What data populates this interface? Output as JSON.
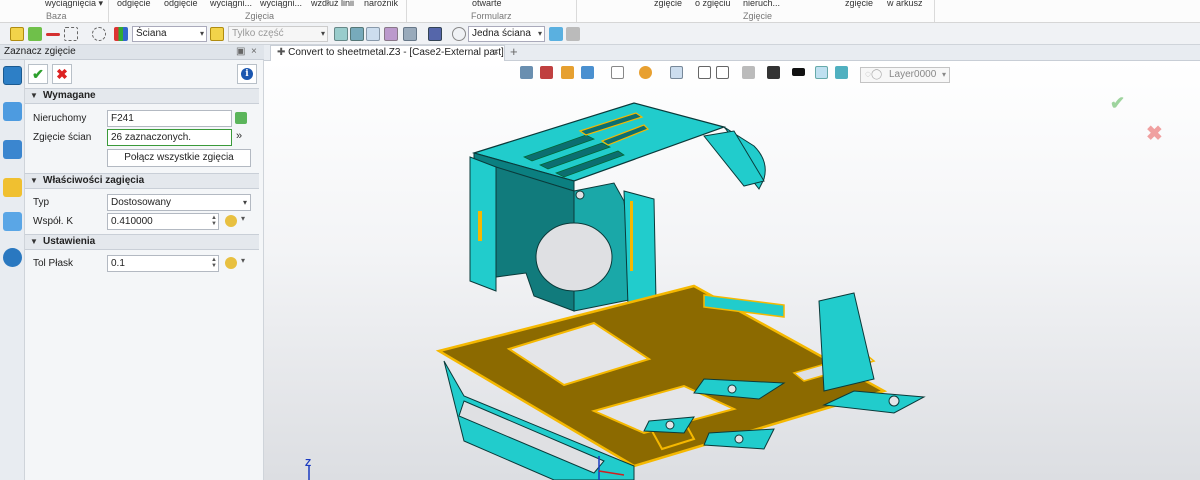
{
  "ribbon": {
    "items": [
      "wyciągnięcia ▾",
      "odgięcie",
      "odgięcie",
      "wyciągni...",
      "wyciągni...",
      "wzdłuż linii",
      "narożnik",
      "otwarte",
      "zgięcie",
      "o zgięciu",
      "nieruch...",
      "zgięcie",
      "w arkusz"
    ],
    "groups": [
      "Baza",
      "Zgięcia",
      "Formularz",
      "Zgięcie"
    ]
  },
  "toolbar": {
    "face_combo": "Ściana",
    "part_combo": "Tylko część",
    "face_mode_combo": "Jedna ściana"
  },
  "panel": {
    "title": "Zaznacz zgięcie",
    "sections": {
      "required": "Wymagane",
      "bend_props": "Właściwości zagięcia",
      "settings": "Ustawienia"
    },
    "fixed_label": "Nieruchomy",
    "fixed_value": "F241",
    "bend_faces_label": "Zgięcie ścian",
    "bend_faces_value": "26 zaznaczonych.",
    "join_button": "Połącz wszystkie zgięcia",
    "type_label": "Typ",
    "type_value": "Dostosowany",
    "k_label": "Współ. K",
    "k_value": "0.410000",
    "tol_label": "Tol Płask",
    "tol_value": "0.1"
  },
  "doc_tab": {
    "label": "Convert to sheetmetal.Z3 - [Case2-External part]",
    "new_tab": "+"
  },
  "viewport": {
    "layer": "Layer0000",
    "triad_z": "Z",
    "accent_teal": "#1ec8c8",
    "accent_gold": "#8c6a00",
    "highlight": "#f5b800"
  },
  "icons": [
    "pointer-icon",
    "filter-icon",
    "check-icon",
    "close-icon",
    "info-icon",
    "lightbulb-icon"
  ]
}
